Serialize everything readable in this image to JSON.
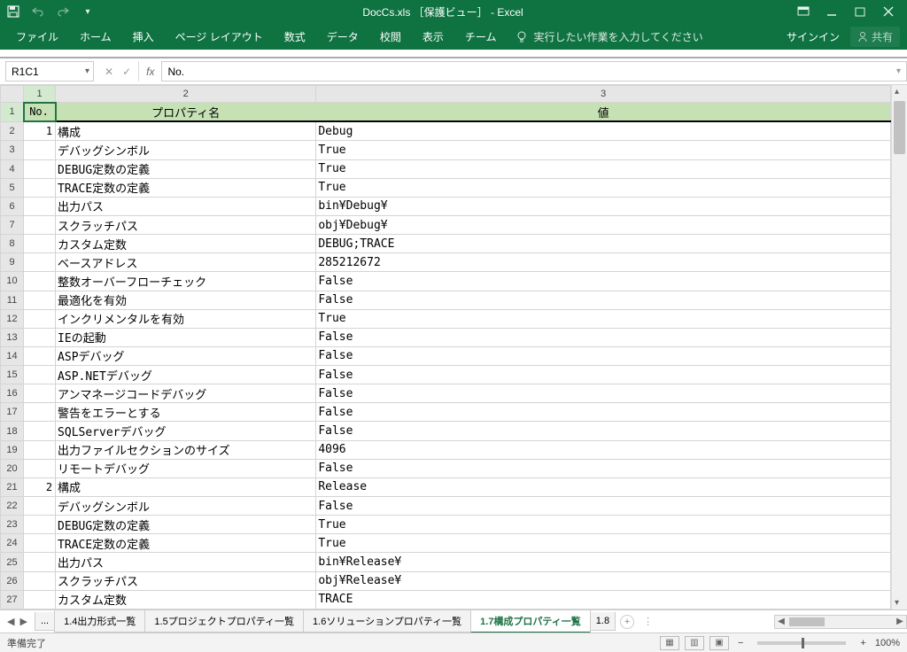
{
  "titlebar": {
    "title": "DocCs.xls ［保護ビュー］ - Excel"
  },
  "ribbon": {
    "tabs": [
      "ファイル",
      "ホーム",
      "挿入",
      "ページ レイアウト",
      "数式",
      "データ",
      "校閲",
      "表示",
      "チーム"
    ],
    "tellme": "実行したい作業を入力してください",
    "signin": "サインイン",
    "share": "共有"
  },
  "formula": {
    "name_box": "R1C1",
    "value": "No."
  },
  "headers": {
    "no": "No.",
    "prop": "プロパティ名",
    "val": "値"
  },
  "rows": [
    {
      "no": "1",
      "p": "構成",
      "v": "Debug"
    },
    {
      "no": "",
      "p": "デバッグシンボル",
      "v": "True"
    },
    {
      "no": "",
      "p": "DEBUG定数の定義",
      "v": "True"
    },
    {
      "no": "",
      "p": "TRACE定数の定義",
      "v": "True"
    },
    {
      "no": "",
      "p": "出力パス",
      "v": "bin¥Debug¥"
    },
    {
      "no": "",
      "p": "スクラッチパス",
      "v": "obj¥Debug¥"
    },
    {
      "no": "",
      "p": "カスタム定数",
      "v": "DEBUG;TRACE"
    },
    {
      "no": "",
      "p": "ベースアドレス",
      "v": "285212672"
    },
    {
      "no": "",
      "p": "整数オーバーフローチェック",
      "v": "False"
    },
    {
      "no": "",
      "p": "最適化を有効",
      "v": "False"
    },
    {
      "no": "",
      "p": "インクリメンタルを有効",
      "v": "True"
    },
    {
      "no": "",
      "p": "IEの起動",
      "v": "False"
    },
    {
      "no": "",
      "p": "ASPデバッグ",
      "v": "False"
    },
    {
      "no": "",
      "p": "ASP.NETデバッグ",
      "v": "False"
    },
    {
      "no": "",
      "p": "アンマネージコードデバッグ",
      "v": "False"
    },
    {
      "no": "",
      "p": "警告をエラーとする",
      "v": "False"
    },
    {
      "no": "",
      "p": "SQLServerデバッグ",
      "v": "False"
    },
    {
      "no": "",
      "p": "出力ファイルセクションのサイズ",
      "v": "4096"
    },
    {
      "no": "",
      "p": "リモートデバッグ",
      "v": "False"
    },
    {
      "no": "2",
      "p": "構成",
      "v": "Release"
    },
    {
      "no": "",
      "p": "デバッグシンボル",
      "v": "False"
    },
    {
      "no": "",
      "p": "DEBUG定数の定義",
      "v": "True"
    },
    {
      "no": "",
      "p": "TRACE定数の定義",
      "v": "True"
    },
    {
      "no": "",
      "p": "出力パス",
      "v": "bin¥Release¥"
    },
    {
      "no": "",
      "p": "スクラッチパス",
      "v": "obj¥Release¥"
    },
    {
      "no": "",
      "p": "カスタム定数",
      "v": "TRACE"
    }
  ],
  "sheets": {
    "prev": "...",
    "tabs": [
      "1.4出力形式一覧",
      "1.5プロジェクトプロパティ一覧",
      "1.6ソリューションプロパティ一覧",
      "1.7構成プロパティ一覧"
    ],
    "next": "1.8",
    "active": 3
  },
  "status": {
    "ready": "準備完了",
    "zoom": "100%"
  }
}
